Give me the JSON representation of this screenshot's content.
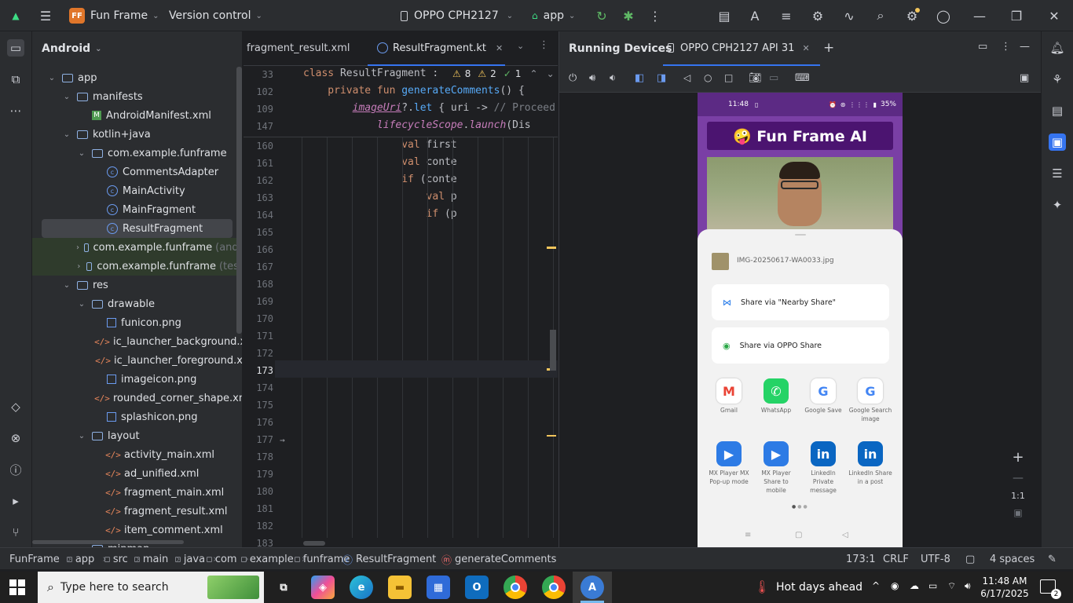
{
  "titlebar": {
    "project_badge": "FF",
    "project_name": "Fun Frame",
    "vcs": "Version control",
    "device": "OPPO CPH2127",
    "run_config": "app"
  },
  "project_panel": {
    "title": "Android",
    "tree": [
      {
        "label": "app",
        "type": "module",
        "indent": 1,
        "chev": "⌄",
        "icon": "folder"
      },
      {
        "label": "manifests",
        "type": "folder",
        "indent": 2,
        "chev": "⌄",
        "icon": "folder"
      },
      {
        "label": "AndroidManifest.xml",
        "type": "manifest",
        "indent": 3,
        "chev": "",
        "icon": "manifest"
      },
      {
        "label": "kotlin+java",
        "type": "folder",
        "indent": 2,
        "chev": "⌄",
        "icon": "folder"
      },
      {
        "label": "com.example.funframe",
        "type": "package",
        "indent": 3,
        "chev": "⌄",
        "icon": "folder"
      },
      {
        "label": "CommentsAdapter",
        "type": "kotlin",
        "indent": 4,
        "chev": "",
        "icon": "kotlin"
      },
      {
        "label": "MainActivity",
        "type": "kotlin",
        "indent": 4,
        "chev": "",
        "icon": "kotlin"
      },
      {
        "label": "MainFragment",
        "type": "kotlin",
        "indent": 4,
        "chev": "",
        "icon": "kotlin"
      },
      {
        "label": "ResultFragment",
        "type": "kotlin",
        "indent": 4,
        "chev": "",
        "icon": "kotlin",
        "selected": true
      },
      {
        "label": "com.example.funframe",
        "suffix": "(andr",
        "type": "package",
        "indent": 3,
        "chev": "›",
        "icon": "folder",
        "test": true
      },
      {
        "label": "com.example.funframe",
        "suffix": "(test",
        "type": "package",
        "indent": 3,
        "chev": "›",
        "icon": "folder",
        "test": true
      },
      {
        "label": "res",
        "type": "folder",
        "indent": 2,
        "chev": "⌄",
        "icon": "folder"
      },
      {
        "label": "drawable",
        "type": "folder",
        "indent": 3,
        "chev": "⌄",
        "icon": "folder"
      },
      {
        "label": "funicon.png",
        "type": "png",
        "indent": 4,
        "chev": "",
        "icon": "png"
      },
      {
        "label": "ic_launcher_background.x",
        "type": "xml",
        "indent": 4,
        "chev": "",
        "icon": "xml"
      },
      {
        "label": "ic_launcher_foreground.x",
        "type": "xml",
        "indent": 4,
        "chev": "",
        "icon": "xml"
      },
      {
        "label": "imageicon.png",
        "type": "png",
        "indent": 4,
        "chev": "",
        "icon": "png"
      },
      {
        "label": "rounded_corner_shape.xn",
        "type": "xml",
        "indent": 4,
        "chev": "",
        "icon": "xml"
      },
      {
        "label": "splashicon.png",
        "type": "png",
        "indent": 4,
        "chev": "",
        "icon": "png"
      },
      {
        "label": "layout",
        "type": "folder",
        "indent": 3,
        "chev": "⌄",
        "icon": "folder"
      },
      {
        "label": "activity_main.xml",
        "type": "xml",
        "indent": 4,
        "chev": "",
        "icon": "xml"
      },
      {
        "label": "ad_unified.xml",
        "type": "xml",
        "indent": 4,
        "chev": "",
        "icon": "xml"
      },
      {
        "label": "fragment_main.xml",
        "type": "xml",
        "indent": 4,
        "chev": "",
        "icon": "xml"
      },
      {
        "label": "fragment_result.xml",
        "type": "xml",
        "indent": 4,
        "chev": "",
        "icon": "xml"
      },
      {
        "label": "item_comment.xml",
        "type": "xml",
        "indent": 4,
        "chev": "",
        "icon": "xml"
      },
      {
        "label": "mipmap",
        "type": "folder",
        "indent": 3,
        "chev": "›",
        "icon": "folder"
      }
    ]
  },
  "editor": {
    "tab_inactive": "fragment_result.xml",
    "tab_active": "ResultFragment.kt",
    "warnings": "8",
    "weak_warnings": "2",
    "ok_count": "1",
    "sticky": [
      {
        "ln": "33",
        "tokens": [
          {
            "t": "class ",
            "c": "kw"
          },
          {
            "t": "ResultFragment : ",
            "c": ""
          }
        ]
      },
      {
        "ln": "102",
        "tokens": [
          {
            "t": "    private fun ",
            "c": "kw"
          },
          {
            "t": "generateComments",
            "c": "fn"
          },
          {
            "t": "() {",
            "c": ""
          }
        ]
      },
      {
        "ln": "109",
        "tokens": [
          {
            "t": "        ",
            "c": ""
          },
          {
            "t": "imageUri",
            "c": "it"
          },
          {
            "t": "?.",
            "c": ""
          },
          {
            "t": "let",
            "c": "fn"
          },
          {
            "t": " { uri -> ",
            "c": ""
          },
          {
            "t": "// Proceed",
            "c": "cm"
          }
        ]
      },
      {
        "ln": "147",
        "tokens": [
          {
            "t": "            ",
            "c": ""
          },
          {
            "t": "lifecycleScope",
            "c": "it"
          },
          {
            "t": ".",
            "c": ""
          },
          {
            "t": "launch",
            "c": "it"
          },
          {
            "t": "(Dis",
            "c": ""
          }
        ]
      }
    ],
    "lines": [
      {
        "ln": "160",
        "text": "                val first",
        "kwlen": 20
      },
      {
        "ln": "161",
        "text": "                val conte",
        "kwlen": 20
      },
      {
        "ln": "162",
        "text": "                if (conte",
        "kwlen": 19
      },
      {
        "ln": "163",
        "text": "                    val p",
        "kwlen": 24
      },
      {
        "ln": "164",
        "text": "                    if (p",
        "kwlen": 23
      },
      {
        "ln": "165",
        "text": "",
        "kwlen": 0
      },
      {
        "ln": "166",
        "text": "",
        "kwlen": 0
      },
      {
        "ln": "167",
        "text": "",
        "kwlen": 0
      },
      {
        "ln": "168",
        "text": "",
        "kwlen": 0
      },
      {
        "ln": "169",
        "text": "",
        "kwlen": 0
      },
      {
        "ln": "170",
        "text": "",
        "kwlen": 0
      },
      {
        "ln": "171",
        "text": "",
        "kwlen": 0
      },
      {
        "ln": "172",
        "text": "",
        "kwlen": 0
      },
      {
        "ln": "173",
        "text": "",
        "kwlen": 0
      },
      {
        "ln": "174",
        "text": "",
        "kwlen": 0
      },
      {
        "ln": "175",
        "text": "",
        "kwlen": 0
      },
      {
        "ln": "176",
        "text": "",
        "kwlen": 0
      },
      {
        "ln": "177",
        "text": "",
        "kwlen": 0
      },
      {
        "ln": "178",
        "text": "",
        "kwlen": 0
      },
      {
        "ln": "179",
        "text": "",
        "kwlen": 0
      },
      {
        "ln": "180",
        "text": "",
        "kwlen": 0
      },
      {
        "ln": "181",
        "text": "",
        "kwlen": 0
      },
      {
        "ln": "182",
        "text": "",
        "kwlen": 0
      },
      {
        "ln": "183",
        "text": "",
        "kwlen": 0
      }
    ]
  },
  "devices": {
    "title": "Running Devices",
    "tab": "OPPO CPH2127 API 31",
    "zoom_label": "1:1",
    "phone": {
      "time": "11:48",
      "battery": "35%",
      "app_title": "🤪 Fun Frame AI",
      "file_name": "IMG-20250617-WA0033.jpg",
      "share_nearby": "Share via \"Nearby Share\"",
      "share_oppo": "Share via OPPO Share",
      "apps": [
        {
          "name": "Gmail",
          "letter": "M",
          "bg": "#ffffff",
          "fg": "#ea4335"
        },
        {
          "name": "WhatsApp",
          "letter": "✆",
          "bg": "#25d366",
          "fg": "#ffffff"
        },
        {
          "name": "Google Save",
          "letter": "G",
          "bg": "#ffffff",
          "fg": "#4285f4"
        },
        {
          "name": "Google Search image",
          "letter": "G",
          "bg": "#ffffff",
          "fg": "#4285f4"
        },
        {
          "name": "MX Player MX Pop-up mode",
          "letter": "▶",
          "bg": "#2d7be5",
          "fg": "#ffffff"
        },
        {
          "name": "MX Player Share to mobile",
          "letter": "▶",
          "bg": "#2d7be5",
          "fg": "#ffffff"
        },
        {
          "name": "LinkedIn Private message",
          "letter": "in",
          "bg": "#0a66c2",
          "fg": "#ffffff"
        },
        {
          "name": "LinkedIn Share in a post",
          "letter": "in",
          "bg": "#0a66c2",
          "fg": "#ffffff"
        }
      ]
    }
  },
  "statusbar": {
    "crumbs": [
      "FunFrame",
      "app",
      "src",
      "main",
      "java",
      "com",
      "example",
      "funframe",
      "ResultFragment",
      "generateComments"
    ],
    "position": "173:1",
    "line_sep": "CRLF",
    "encoding": "UTF-8",
    "indent": "4 spaces"
  },
  "taskbar": {
    "search_placeholder": "Type here to search",
    "weather": "Hot days ahead",
    "time": "11:48 AM",
    "date": "6/17/2025",
    "notif_count": "2"
  },
  "colors": {
    "accent": "#3574f0",
    "selection": "#43454a",
    "project_badge": "#e0762a"
  }
}
